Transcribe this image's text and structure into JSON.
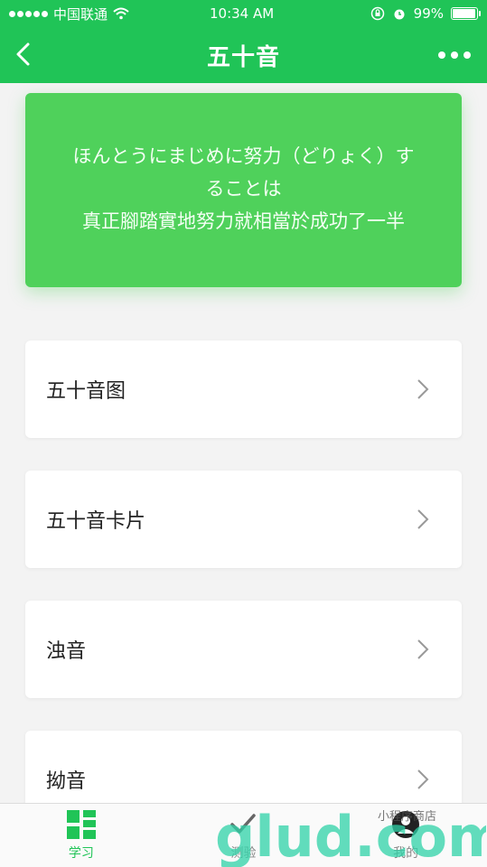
{
  "status": {
    "carrier": "中国联通",
    "time": "10:34 AM",
    "battery_text": "99%",
    "battery_level": 0.99
  },
  "nav": {
    "title": "五十音",
    "back_icon": "chevron-left-icon",
    "more_icon": "more-dots-icon"
  },
  "banner": {
    "line1": "ほんとうにまじめに努力（どりょく）す",
    "line2": "ることは",
    "line3": "真正腳踏實地努力就相當於成功了一半"
  },
  "menu": [
    {
      "label": "五十音图"
    },
    {
      "label": "五十音卡片"
    },
    {
      "label": "浊音"
    },
    {
      "label": "拗音"
    }
  ],
  "tabs": [
    {
      "label": "学习",
      "icon": "grid-icon",
      "active": true
    },
    {
      "label": "测验",
      "icon": "check-icon",
      "active": false
    },
    {
      "label": "我的",
      "icon": "user-icon",
      "active": false
    }
  ],
  "watermark": {
    "text": "glud.com",
    "subtext": "小程序商店"
  },
  "colors": {
    "primary": "#20c457",
    "banner": "#4fd15b",
    "background": "#f3f3f3",
    "tab_inactive": "#888888"
  }
}
